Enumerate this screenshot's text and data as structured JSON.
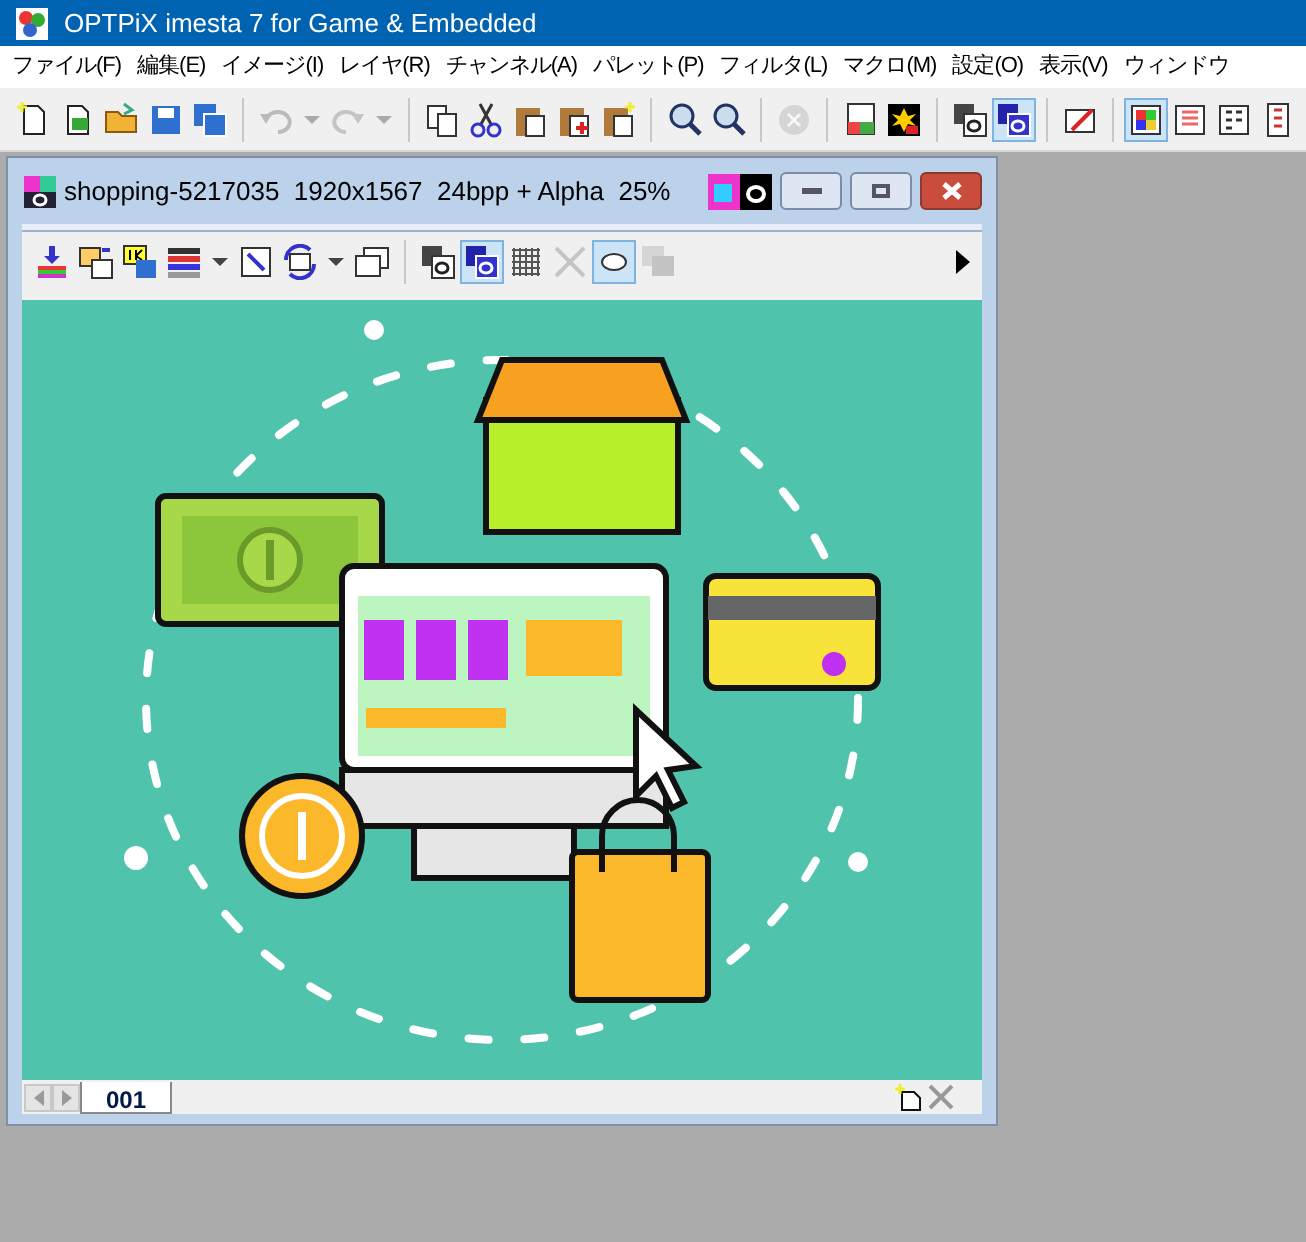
{
  "window": {
    "title": "OPTPiX imesta 7 for Game & Embedded"
  },
  "menu": [
    "ファイル(F)",
    "編集(E)",
    "イメージ(I)",
    "レイヤ(R)",
    "チャンネル(A)",
    "パレット(P)",
    "フィルタ(L)",
    "マクロ(M)",
    "設定(O)",
    "表示(V)",
    "ウィンドウ"
  ],
  "main_toolbar": [
    {
      "pressed": false,
      "disabled": false
    },
    {
      "pressed": false,
      "disabled": false
    },
    {
      "pressed": false,
      "disabled": false
    },
    {
      "pressed": false,
      "disabled": false
    },
    {
      "pressed": false,
      "disabled": false
    },
    {
      "pressed": false,
      "disabled": true
    },
    {
      "pressed": false,
      "disabled": true
    },
    {
      "pressed": false,
      "disabled": false
    },
    {
      "pressed": false,
      "disabled": false
    },
    {
      "pressed": false,
      "disabled": false
    },
    {
      "pressed": false,
      "disabled": false
    },
    {
      "pressed": false,
      "disabled": false
    },
    {
      "pressed": false,
      "disabled": false
    },
    {
      "pressed": false,
      "disabled": false
    },
    {
      "pressed": false,
      "disabled": true
    },
    {
      "pressed": false,
      "disabled": false
    },
    {
      "pressed": false,
      "disabled": false
    },
    {
      "pressed": false,
      "disabled": false
    },
    {
      "pressed": true,
      "disabled": false
    },
    {
      "pressed": false,
      "disabled": false
    },
    {
      "pressed": true,
      "disabled": false
    },
    {
      "pressed": false,
      "disabled": false
    },
    {
      "pressed": false,
      "disabled": false
    },
    {
      "pressed": false,
      "disabled": false
    }
  ],
  "document": {
    "title": "shopping-5217035  1920x1567  24bpp + Alpha  25%",
    "toolbar": [
      {
        "pressed": false,
        "disabled": false
      },
      {
        "pressed": false,
        "disabled": false
      },
      {
        "pressed": false,
        "disabled": false
      },
      {
        "pressed": false,
        "disabled": false
      },
      {
        "pressed": false,
        "disabled": false
      },
      {
        "pressed": false,
        "disabled": false
      },
      {
        "pressed": false,
        "disabled": false
      },
      {
        "pressed": false,
        "disabled": false
      },
      {
        "pressed": true,
        "disabled": false
      },
      {
        "pressed": false,
        "disabled": false
      },
      {
        "pressed": false,
        "disabled": true
      },
      {
        "pressed": true,
        "disabled": false
      },
      {
        "pressed": false,
        "disabled": true
      }
    ],
    "tabs": [
      {
        "label": "001",
        "selected": true
      }
    ]
  }
}
